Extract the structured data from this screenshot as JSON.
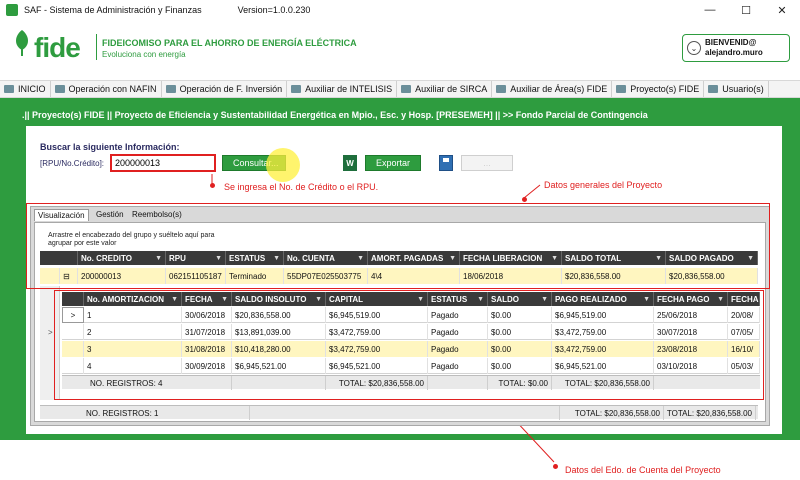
{
  "window": {
    "title": "SAF - Sistema de Administración y Finanzas",
    "version": "Version=1.0.0.230",
    "controls": [
      "—",
      "☐",
      "✕"
    ]
  },
  "header": {
    "logo": "fide",
    "tagline1": "FIDEICOMISO PARA EL AHORRO DE ENERGÍA ELÉCTRICA",
    "tagline2": "Evoluciona con energía",
    "user_line1": "BIENVENID@",
    "user_line2": "alejandro.muro"
  },
  "menu": [
    {
      "label": "INICIO",
      "icon": "home-icon"
    },
    {
      "label": "Operación con NAFIN",
      "icon": "menu-icon"
    },
    {
      "label": "Operación de F. Inversión",
      "icon": "menu-icon"
    },
    {
      "label": "Auxiliar de INTELISIS",
      "icon": "menu-icon"
    },
    {
      "label": "Auxiliar de SIRCA",
      "icon": "menu-icon"
    },
    {
      "label": "Auxiliar de Área(s) FIDE",
      "icon": "menu-icon"
    },
    {
      "label": "Proyecto(s) FIDE",
      "icon": "menu-icon"
    },
    {
      "label": "Usuario(s)",
      "icon": "menu-icon"
    }
  ],
  "breadcrumb": ".|| Proyecto(s) FIDE || Proyecto de Eficiencia y Sustentabilidad Energética en Mpio., Esc. y Hosp. [PRESEMEH] || >> Fondo Parcial de Contingencia",
  "search": {
    "title": "Buscar la siguiente Información:",
    "label": "[RPU/No.Crédito]:",
    "value": "200000013",
    "consultar": "Consultar...",
    "exportar": "Exportar",
    "excel_icon": "W",
    "disabled_label": "..."
  },
  "annotations": {
    "input_note": "Se ingresa el No. de Crédito o el RPU.",
    "general_note": "Datos generales del Proyecto",
    "detail_note": "Datos del Edo. de Cuenta del Proyecto"
  },
  "tabs": [
    "Visualización",
    "Gestión",
    "Reembolso(s)"
  ],
  "group_hint": "Arrastre el encabezado del grupo y suéltelo aquí para agrupar por este valor",
  "master": {
    "columns": [
      "No. CREDITO",
      "RPU",
      "ESTATUS",
      "No. CUENTA",
      "AMORT. PAGADAS",
      "FECHA LIBERACION",
      "SALDO TOTAL",
      "SALDO PAGADO"
    ],
    "row": [
      "200000013",
      "062151105187",
      "Terminado",
      "55DP07E025503775",
      "4\\4",
      "18/06/2018",
      "$20,836,558.00",
      "$20,836,558.00"
    ],
    "footer_label": "NO. REGISTROS: 1",
    "footer_total1": "TOTAL: $20,836,558.00",
    "footer_total2": "TOTAL: $20,836,558.00"
  },
  "detail": {
    "columns": [
      "No. AMORTIZACION",
      "FECHA",
      "SALDO INSOLUTO",
      "CAPITAL",
      "ESTATUS",
      "SALDO",
      "PAGO REALIZADO",
      "FECHA PAGO",
      "FECHA"
    ],
    "rows": [
      [
        "1",
        "30/06/2018",
        "$20,836,558.00",
        "$6,945,519.00",
        "Pagado",
        "$0.00",
        "$6,945,519.00",
        "25/06/2018",
        "20/08/"
      ],
      [
        "2",
        "31/07/2018",
        "$13,891,039.00",
        "$3,472,759.00",
        "Pagado",
        "$0.00",
        "$3,472,759.00",
        "30/07/2018",
        "07/05/"
      ],
      [
        "3",
        "31/08/2018",
        "$10,418,280.00",
        "$3,472,759.00",
        "Pagado",
        "$0.00",
        "$3,472,759.00",
        "23/08/2018",
        "16/10/"
      ],
      [
        "4",
        "30/09/2018",
        "$6,945,521.00",
        "$6,945,521.00",
        "Pagado",
        "$0.00",
        "$6,945,521.00",
        "03/10/2018",
        "05/03/"
      ]
    ],
    "footer_label": "NO. REGISTROS: 4",
    "footer_capital": "TOTAL: $20,836,558.00",
    "footer_saldo": "TOTAL: $0.00",
    "footer_pago": "TOTAL: $20,836,558.00"
  },
  "colors": {
    "brand_green": "#2e9c3f",
    "annotation_red": "#e02020",
    "header_dark": "#3a3a3a",
    "selected_row": "#fff6c0"
  }
}
